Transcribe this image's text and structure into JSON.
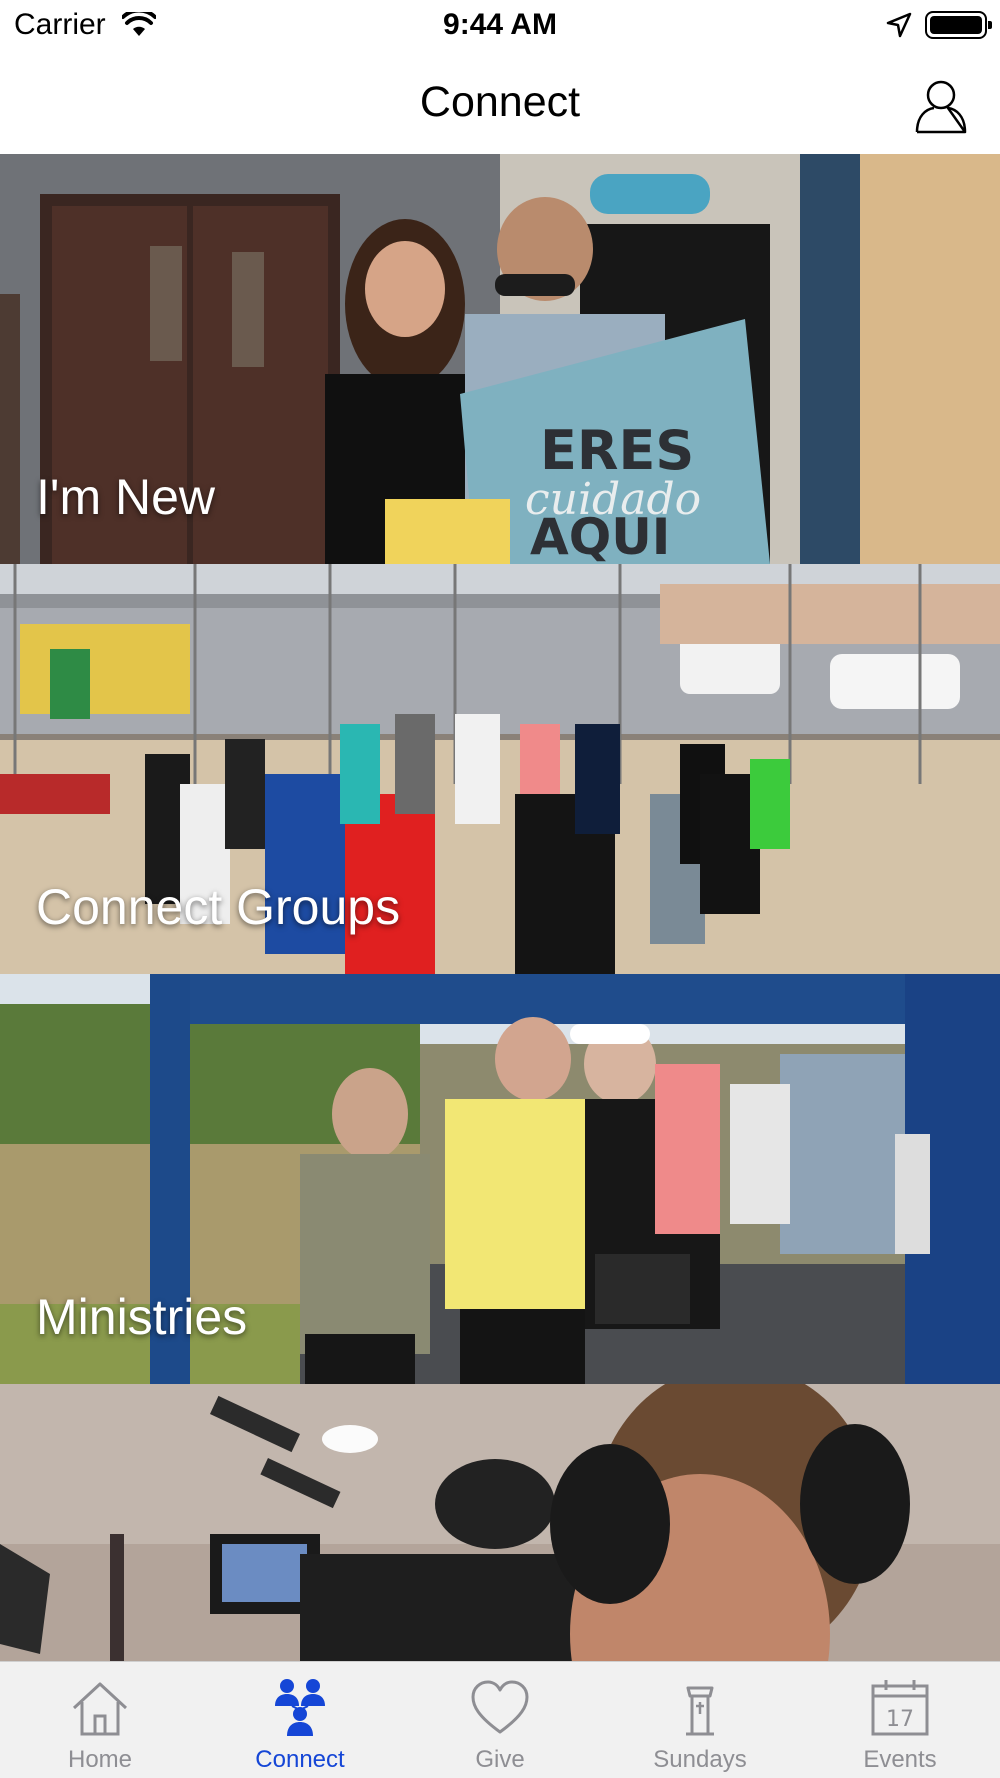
{
  "status_bar": {
    "carrier": "Carrier",
    "time": "9:44 AM"
  },
  "nav": {
    "title": "Connect",
    "profile_icon": "person-outline-icon"
  },
  "cards": [
    {
      "label": "I'm New",
      "photo": "two people holding a sign in church lobby"
    },
    {
      "label": "Connect Groups",
      "photo": "group holding hands in a circle outdoors"
    },
    {
      "label": "Ministries",
      "photo": "people at an outdoor tent event"
    },
    {
      "label": "",
      "photo": "camera operator with headphones"
    }
  ],
  "tab_bar": {
    "items": [
      {
        "label": "Home",
        "icon": "house-icon",
        "active": false
      },
      {
        "label": "Connect",
        "icon": "people-group-icon",
        "active": true
      },
      {
        "label": "Give",
        "icon": "heart-icon",
        "active": false
      },
      {
        "label": "Sundays",
        "icon": "lectern-icon",
        "active": false
      },
      {
        "label": "Events",
        "icon": "calendar-icon",
        "active": false
      }
    ]
  },
  "colors": {
    "accent": "#1546d6",
    "tab_inactive": "#8e8e93",
    "tab_bar_bg": "#f1f1f1"
  }
}
